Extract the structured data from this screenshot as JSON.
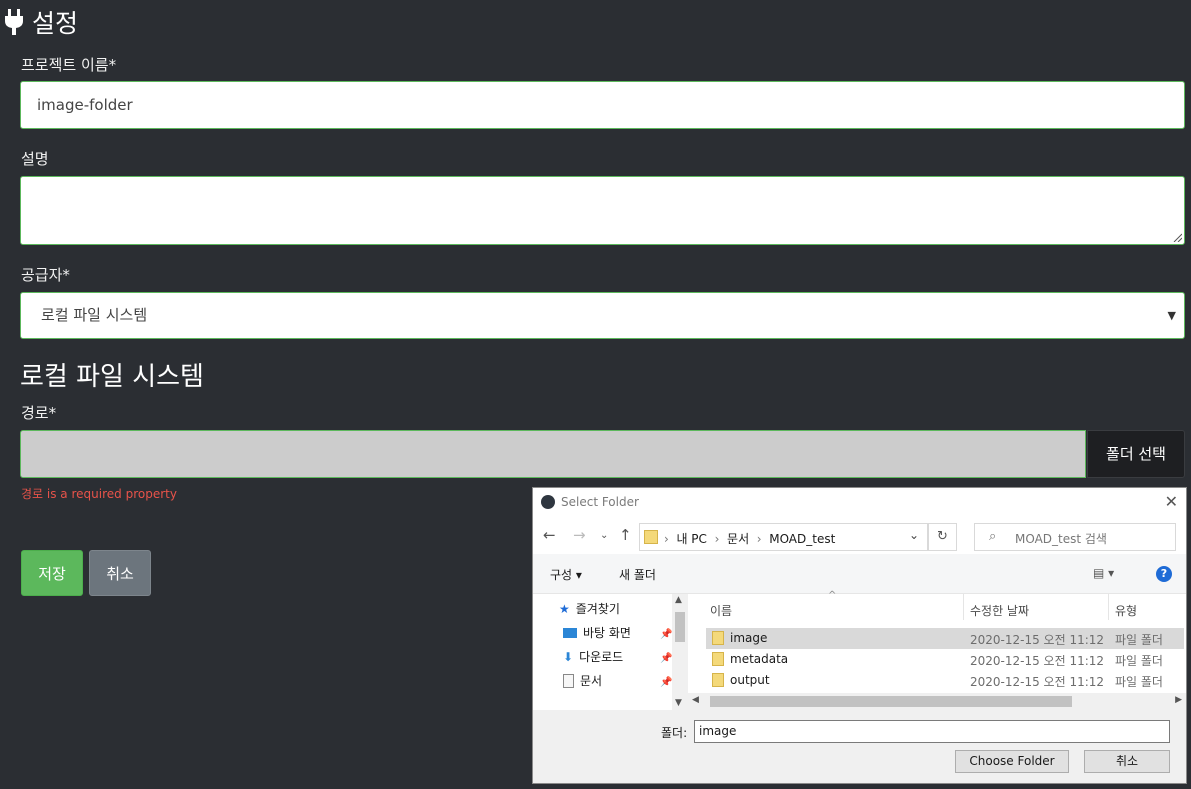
{
  "header": {
    "title": "설정",
    "icon": "plug-icon"
  },
  "form": {
    "project_name_label": "프로젝트 이름*",
    "project_name_value": "image-folder",
    "description_label": "설명",
    "description_value": "",
    "provider_label": "공급자*",
    "provider_value": "로컬 파일 시스템",
    "section_title": "로컬 파일 시스템",
    "path_label": "경로*",
    "path_value": "",
    "select_folder_button": "폴더 선택",
    "path_error_prefix": "경로",
    "path_error_suffix": " is a required property",
    "save_button": "저장",
    "cancel_button": "취소"
  },
  "dialog": {
    "title": "Select Folder",
    "address": {
      "segments": [
        "내 PC",
        "문서",
        "MOAD_test"
      ],
      "separator": "›"
    },
    "search_placeholder": "MOAD_test 검색",
    "toolbar": {
      "organize": "구성",
      "new_folder": "새 폴더"
    },
    "nav_items": [
      {
        "label": "즐겨찾기",
        "icon": "star-icon"
      },
      {
        "label": "바탕 화면",
        "icon": "desktop-icon",
        "pinned": true
      },
      {
        "label": "다운로드",
        "icon": "download-icon",
        "pinned": true
      },
      {
        "label": "문서",
        "icon": "document-icon",
        "pinned": true
      }
    ],
    "columns": {
      "name": "이름",
      "modified": "수정한 날짜",
      "type": "유형"
    },
    "files": [
      {
        "name": "image",
        "modified": "2020-12-15 오전 11:12",
        "type": "파일 폴더",
        "selected": true
      },
      {
        "name": "metadata",
        "modified": "2020-12-15 오전 11:12",
        "type": "파일 폴더"
      },
      {
        "name": "output",
        "modified": "2020-12-15 오전 11:12",
        "type": "파일 폴더"
      }
    ],
    "folder_label": "폴더:",
    "folder_value": "image",
    "choose_button": "Choose Folder",
    "cancel_button": "취소"
  },
  "colors": {
    "background": "#2b2e33",
    "success": "#5cb85c",
    "secondary": "#6c757d",
    "error": "#e8534a"
  }
}
